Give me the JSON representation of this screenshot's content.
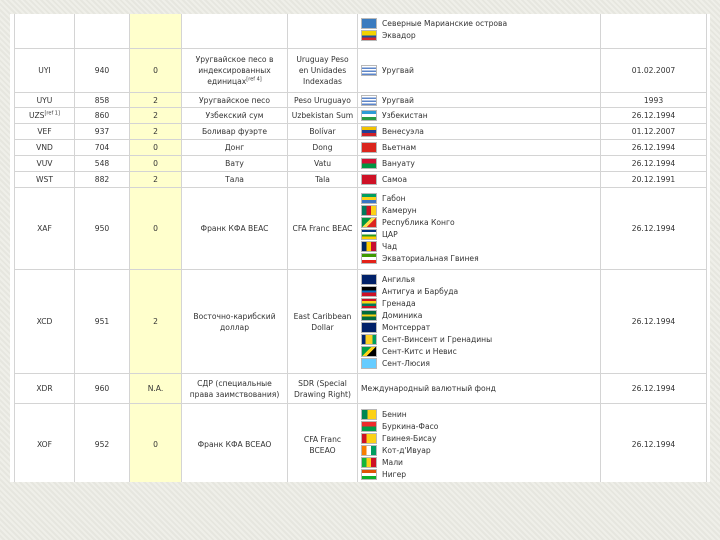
{
  "table": {
    "rows": [
      {
        "code": "",
        "num": "",
        "minor": "",
        "name_ru": "",
        "name_en": "",
        "countries": [
          {
            "name": "Северные Марианские острова",
            "flag": "flag-mp"
          },
          {
            "name": "Эквадор",
            "flag": "flag-ec"
          }
        ],
        "date": "",
        "h": 38
      },
      {
        "code": "UYI",
        "num": "940",
        "minor": "0",
        "name_ru": "Уругвайское песо в индексированных единицах",
        "name_ru_sup": "[ref 4]",
        "name_en": "Uruguay Peso en Unidades Indexadas",
        "countries": [
          {
            "name": "Уругвай",
            "flag": "flag-uy"
          }
        ],
        "date": "01.02.2007",
        "h": 44
      },
      {
        "code": "UYU",
        "num": "858",
        "minor": "2",
        "name_ru": "Уругвайское песо",
        "name_en": "Peso Uruguayo",
        "countries": [
          {
            "name": "Уругвай",
            "flag": "flag-uy"
          }
        ],
        "date": "1993",
        "h": 14
      },
      {
        "code": "UZS",
        "code_sup": "[ref 1]",
        "num": "860",
        "minor": "2",
        "name_ru": "Узбекский сум",
        "name_en": "Uzbekistan Sum",
        "countries": [
          {
            "name": "Узбекистан",
            "flag": "flag-uz"
          }
        ],
        "date": "26.12.1994",
        "h": 16
      },
      {
        "code": "VEF",
        "num": "937",
        "minor": "2",
        "name_ru": "Боливар фуэрте",
        "name_en": "Bolívar",
        "countries": [
          {
            "name": "Венесуэла",
            "flag": "flag-ve"
          }
        ],
        "date": "01.12.2007",
        "h": 16
      },
      {
        "code": "VND",
        "num": "704",
        "minor": "0",
        "name_ru": "Донг",
        "name_en": "Dong",
        "countries": [
          {
            "name": "Вьетнам",
            "flag": "flag-vn"
          }
        ],
        "date": "26.12.1994",
        "h": 16
      },
      {
        "code": "VUV",
        "num": "548",
        "minor": "0",
        "name_ru": "Вату",
        "name_en": "Vatu",
        "countries": [
          {
            "name": "Вануату",
            "flag": "flag-vu"
          }
        ],
        "date": "26.12.1994",
        "h": 16
      },
      {
        "code": "WST",
        "num": "882",
        "minor": "2",
        "name_ru": "Тала",
        "name_en": "Tala",
        "countries": [
          {
            "name": "Самоа",
            "flag": "flag-ws"
          }
        ],
        "date": "20.12.1991",
        "h": 16
      },
      {
        "code": "XAF",
        "num": "950",
        "minor": "0",
        "name_ru": "Франк КФА BEAC",
        "name_en": "CFA Franc BEAC",
        "countries": [
          {
            "name": "Габон",
            "flag": "flag-ga"
          },
          {
            "name": "Камерун",
            "flag": "flag-cm"
          },
          {
            "name": "Республика Конго",
            "flag": "flag-cg"
          },
          {
            "name": "ЦАР",
            "flag": "flag-cf"
          },
          {
            "name": "Чад",
            "flag": "flag-td"
          },
          {
            "name": "Экваториальная Гвинея",
            "flag": "flag-gq"
          }
        ],
        "date": "26.12.1994",
        "h": 82
      },
      {
        "code": "XCD",
        "num": "951",
        "minor": "2",
        "name_ru": "Восточно-карибский доллар",
        "name_en": "East Caribbean Dollar",
        "countries": [
          {
            "name": "Ангилья",
            "flag": "flag-ai"
          },
          {
            "name": "Антигуа и Барбуда",
            "flag": "flag-ag"
          },
          {
            "name": "Гренада",
            "flag": "flag-gd"
          },
          {
            "name": "Доминика",
            "flag": "flag-dm"
          },
          {
            "name": "Монтсеррат",
            "flag": "flag-ms"
          },
          {
            "name": "Сент-Винсент и Гренадины",
            "flag": "flag-vc"
          },
          {
            "name": "Сент-Китс и Невис",
            "flag": "flag-kn"
          },
          {
            "name": "Сент-Люсия",
            "flag": "flag-lc"
          }
        ],
        "date": "26.12.1994",
        "h": 104
      },
      {
        "code": "XDR",
        "num": "960",
        "minor": "N.A.",
        "name_ru": "СДР (специальные права заимствования)",
        "name_en": "SDR (Special Drawing Right)",
        "countries": [
          {
            "name": "Международный валютный фонд",
            "flag": ""
          }
        ],
        "date": "26.12.1994",
        "h": 30
      },
      {
        "code": "XOF",
        "num": "952",
        "minor": "0",
        "name_ru": "Франк КФА BCEAO",
        "name_en": "CFA Franc BCEAO",
        "countries": [
          {
            "name": "Бенин",
            "flag": "flag-bj"
          },
          {
            "name": "Буркина-Фасо",
            "flag": "flag-bf"
          },
          {
            "name": "Гвинея-Бисау",
            "flag": "flag-gw"
          },
          {
            "name": "Кот-д'Ивуар",
            "flag": "flag-ci"
          },
          {
            "name": "Мали",
            "flag": "flag-ml"
          },
          {
            "name": "Нигер",
            "flag": "flag-ne"
          }
        ],
        "date": "26.12.1994",
        "h": 82
      }
    ]
  },
  "flag_colors": {
    "flag-mp": "linear-gradient(#3a7bbf,#3a7bbf)",
    "flag-ec": "linear-gradient(#f3d200 0 50%,#1a4fa0 50% 75%,#d62828 75%)",
    "flag-uy": "repeating-linear-gradient(#ffffff 0 1.5px,#5d86c9 1.5px 3px)",
    "flag-uz": "linear-gradient(#2e9cd6 0 33%,#ffffff 33% 66%,#2a9b45 66%)",
    "flag-ve": "linear-gradient(#f2c200 0 33%,#1f3f96 33% 66%,#cf2027 66%)",
    "flag-vn": "linear-gradient(#da251d,#da251d)",
    "flag-vu": "linear-gradient(#d21034 0 50%,#009543 50%)",
    "flag-ws": "linear-gradient(#ce1126,#ce1126)",
    "flag-ga": "linear-gradient(#009e60 0 33%,#fcd116 33% 66%,#3a75c4 66%)",
    "flag-cm": "linear-gradient(90deg,#007a5e 0 33%,#ce1126 33% 66%,#fcd116 66%)",
    "flag-cg": "linear-gradient(135deg,#009543 0 40%,#fbde4a 40% 60%,#dc241f 60%)",
    "flag-cf": "linear-gradient(#003082 0 25%,#ffffff 25% 50%,#289728 50% 75%,#ffce00 75%)",
    "flag-td": "linear-gradient(90deg,#002664 0 33%,#fecb00 33% 66%,#c60c30 66%)",
    "flag-gq": "linear-gradient(#3e9a00 0 33%,#ffffff 33% 66%,#e32118 66%)",
    "flag-ai": "linear-gradient(#012169,#012169)",
    "flag-ag": "linear-gradient(#000000 0 40%,#0072c6 40% 60%,#ce1126 60%)",
    "flag-gd": "linear-gradient(#ce1126 0 20%,#fcd116 20% 50%,#007a5e 50% 80%,#ce1126 80%)",
    "flag-dm": "linear-gradient(#006b3f 0 40%,#fcd116 40% 60%,#006b3f 60%)",
    "flag-ms": "linear-gradient(#012169,#012169)",
    "flag-vc": "linear-gradient(90deg,#002674 0 25%,#fcd022 25% 75%,#009e60 75%)",
    "flag-kn": "linear-gradient(135deg,#009e49 0 40%,#fcd116 40% 60%,#000000 60%)",
    "flag-lc": "linear-gradient(#66ccff,#66ccff)",
    "flag-bj": "linear-gradient(90deg,#008751 0 40%,#fcd116 40%)",
    "flag-bf": "linear-gradient(#ef2b2d 0 50%,#009e49 50%)",
    "flag-gw": "linear-gradient(90deg,#ce1126 0 33%,#fcd116 33%)",
    "flag-ci": "linear-gradient(90deg,#f77f00 0 33%,#ffffff 33% 66%,#009e60 66%)",
    "flag-ml": "linear-gradient(90deg,#14b53a 0 33%,#fcd116 33% 66%,#ce1126 66%)",
    "flag-ne": "linear-gradient(#e05206 0 33%,#ffffff 33% 66%,#0db02b 66%)"
  },
  "colors": {
    "minor_units_bg": "#ffffcc",
    "border": "#d4d4d4",
    "text": "#333333"
  }
}
